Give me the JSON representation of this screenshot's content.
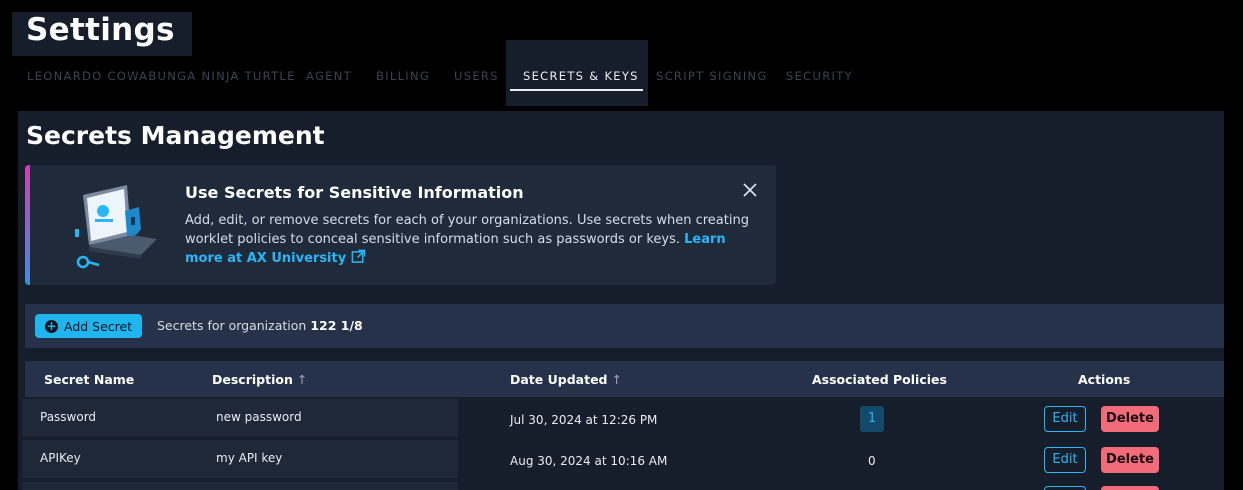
{
  "page": {
    "title": "Settings"
  },
  "tabs": [
    {
      "label": "LEONARDO COWABUNGA NINJA TURTLE",
      "active": false
    },
    {
      "label": "AGENT",
      "active": false
    },
    {
      "label": "BILLING",
      "active": false
    },
    {
      "label": "USERS",
      "active": false
    },
    {
      "label": "SECRETS & KEYS",
      "active": true
    },
    {
      "label": "SCRIPT SIGNING",
      "active": false
    },
    {
      "label": "SECURITY",
      "active": false
    }
  ],
  "section": {
    "title": "Secrets Management"
  },
  "banner": {
    "title": "Use Secrets for Sensitive Information",
    "body": "Add, edit, or remove secrets for each of your organizations. Use secrets when creating worklet policies to conceal sensitive information such as passwords or keys.",
    "link_label": "Learn more at AX University",
    "close_icon": "close-icon",
    "external_icon": "external-link-icon"
  },
  "toolbar": {
    "add_label": "Add Secret",
    "org_prefix": "Secrets for organization",
    "org_value": "122 1/8"
  },
  "table": {
    "columns": [
      {
        "label": "Secret Name",
        "sort": ""
      },
      {
        "label": "Description",
        "sort": "↑"
      },
      {
        "label": "Date Updated",
        "sort": "↑"
      },
      {
        "label": "Associated Policies",
        "sort": ""
      },
      {
        "label": "Actions",
        "sort": ""
      }
    ],
    "rows": [
      {
        "name": "Password",
        "description": "new password",
        "date": "Jul 30, 2024 at 12:26 PM",
        "policies": "1",
        "policies_link": true,
        "edit": "Edit",
        "delete": "Delete"
      },
      {
        "name": "APIKey",
        "description": "my API key",
        "date": "Aug 30, 2024 at 10:16 AM",
        "policies": "0",
        "policies_link": false,
        "edit": "Edit",
        "delete": "Delete"
      }
    ]
  },
  "colors": {
    "accent": "#29b6f6",
    "add_button": "#1fb6f0",
    "danger": "#f26b7a",
    "panel_bg": "#161e2b",
    "header_bg": "#25324a"
  }
}
